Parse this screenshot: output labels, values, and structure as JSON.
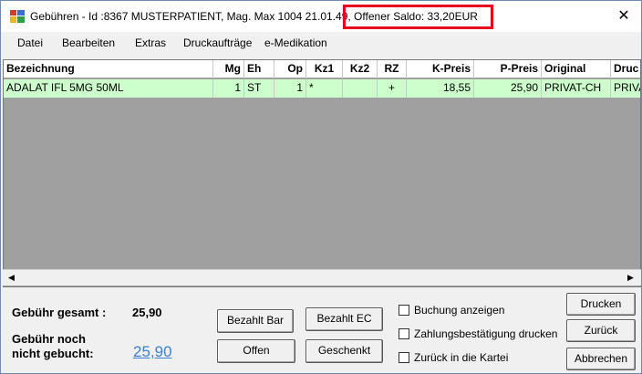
{
  "window": {
    "title": "Gebühren - Id :8367 MUSTERPATIENT, Mag. Max 1004 21.01.49, Offener Saldo: 33,20EUR",
    "close_glyph": "✕",
    "icon": "app-icon"
  },
  "menu": [
    "Datei",
    "Bearbeiten",
    "Extras",
    "Druckaufträge",
    "e-Medikation"
  ],
  "table": {
    "columns": [
      "Bezeichnung",
      "Mg",
      "Eh",
      "Op",
      "Kz1",
      "Kz2",
      "RZ",
      "K-Preis",
      "P-Preis",
      "Original",
      "Druc"
    ],
    "rows": [
      [
        "ADALAT IFL 5MG 50ML",
        "1",
        "ST",
        "1",
        "*",
        "",
        "+",
        "18,55",
        "25,90",
        "PRIVAT-CH",
        "PRIVA"
      ]
    ],
    "row_color": "#ccffcc"
  },
  "summary": {
    "total_label": "Gebühr gesamt :",
    "total_value": "25,90",
    "unbooked_label_line1": "Gebühr noch",
    "unbooked_label_line2": "nicht gebucht:",
    "unbooked_value": "25,90"
  },
  "buttons": {
    "paid_cash": "Bezahlt Bar",
    "paid_ec": "Bezahlt EC",
    "open": "Offen",
    "gift": "Geschenkt",
    "print": "Drucken",
    "back": "Zurück",
    "cancel": "Abbrechen"
  },
  "checkboxes": {
    "show_booking": "Buchung anzeigen",
    "print_payment_confirmation": "Zahlungsbestätigung drucken",
    "back_to_card": "Zurück in die Kartei"
  },
  "scroll": {
    "left_glyph": "◀",
    "right_glyph": "▶"
  }
}
